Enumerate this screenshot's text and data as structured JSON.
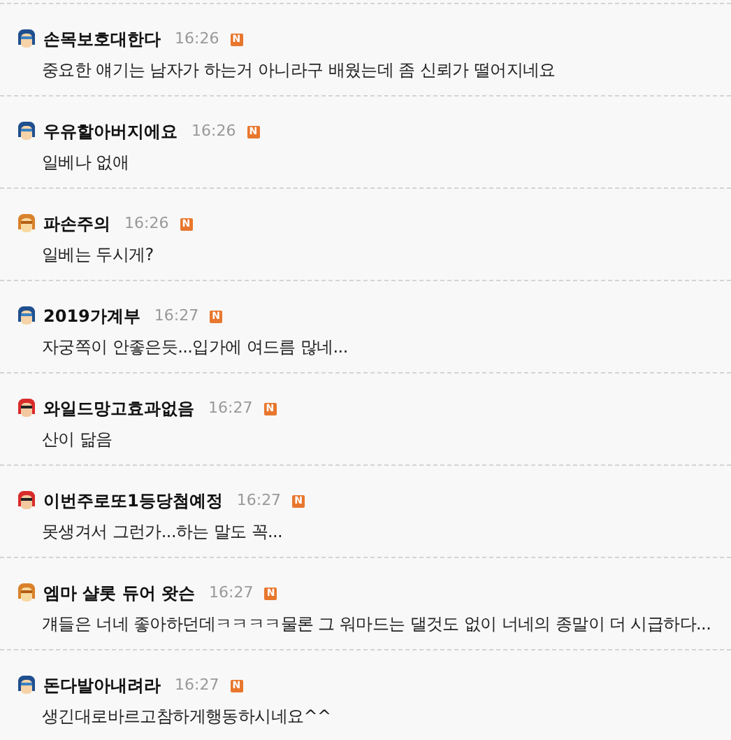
{
  "comments": [
    {
      "kind": "blue",
      "author": "손목보호대한다",
      "time": "16:26",
      "badge": "N",
      "text": "중요한 얘기는 남자가 하는거 아니라구 배웠는데 좀 신뢰가 떨어지네요"
    },
    {
      "kind": "blue",
      "author": "우유할아버지에요",
      "time": "16:26",
      "badge": "N",
      "text": "일베나 없애"
    },
    {
      "kind": "orange",
      "author": "파손주의",
      "time": "16:26",
      "badge": "N",
      "text": "일베는 두시게?"
    },
    {
      "kind": "blue",
      "author": "2019가계부",
      "time": "16:27",
      "badge": "N",
      "text": "자궁쪽이 안좋은듯...입가에 여드름 많네..."
    },
    {
      "kind": "red",
      "author": "와일드망고효과없음",
      "time": "16:27",
      "badge": "N",
      "text": "산이 닮음"
    },
    {
      "kind": "red",
      "author": "이번주로또1등당첨예정",
      "time": "16:27",
      "badge": "N",
      "text": "못생겨서 그런가...하는 말도 꼭..."
    },
    {
      "kind": "orange",
      "author": "엠마 샬롯 듀어 왓슨",
      "time": "16:27",
      "badge": "N",
      "text": "걔들은 너네 좋아하던데ㅋㅋㅋㅋ물론 그 워마드는 댈것도 없이 너네의 종말이 더 시급하다..."
    },
    {
      "kind": "blue",
      "author": "돈다발아내려라",
      "time": "16:27",
      "badge": "N",
      "text": "생긴대로바르고참하게행동하시네요^^"
    }
  ]
}
